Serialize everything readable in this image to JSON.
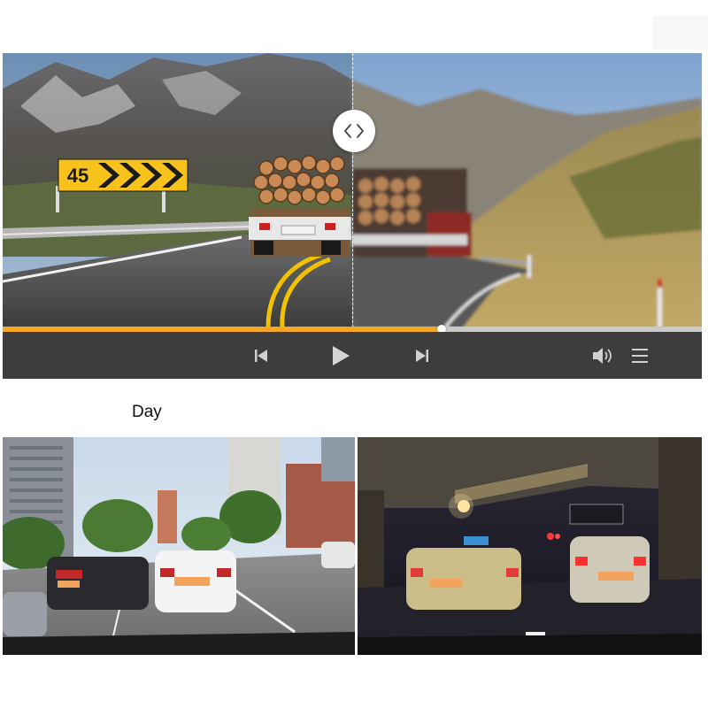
{
  "hero": {
    "sign_text": "45",
    "playback": {
      "progress_fraction": 0.628
    },
    "controls": {
      "prev": "skip-previous-icon",
      "play": "play-icon",
      "next": "skip-next-icon",
      "volume": "volume-icon",
      "menu": "menu-icon"
    }
  },
  "day_section": {
    "label": "Day"
  },
  "colors": {
    "accent_progress": "#f5a623",
    "control_bar": "#3d3d3d",
    "sign_yellow": "#f7c21c"
  }
}
